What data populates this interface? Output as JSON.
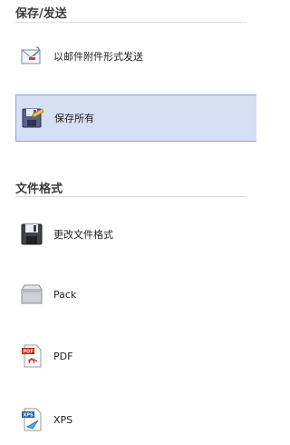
{
  "sections": {
    "save_send": {
      "title": "保存/发送",
      "items": [
        {
          "label": "以邮件附件形式发送",
          "icon": "envelope-attachment-icon"
        },
        {
          "label": "保存所有",
          "icon": "save-all-icon",
          "selected": true
        }
      ]
    },
    "file_format": {
      "title": "文件格式",
      "items": [
        {
          "label": "更改文件格式",
          "icon": "floppy-disk-icon"
        },
        {
          "label": "Pack",
          "icon": "package-box-icon"
        },
        {
          "label": "PDF",
          "icon": "pdf-file-icon"
        },
        {
          "label": "XPS",
          "icon": "xps-file-icon"
        }
      ]
    }
  },
  "colors": {
    "selected_bg": "#d6e0f4",
    "selected_border": "#8ea4d0",
    "divider": "#d9dde3",
    "header_text": "#3c3c3c"
  }
}
